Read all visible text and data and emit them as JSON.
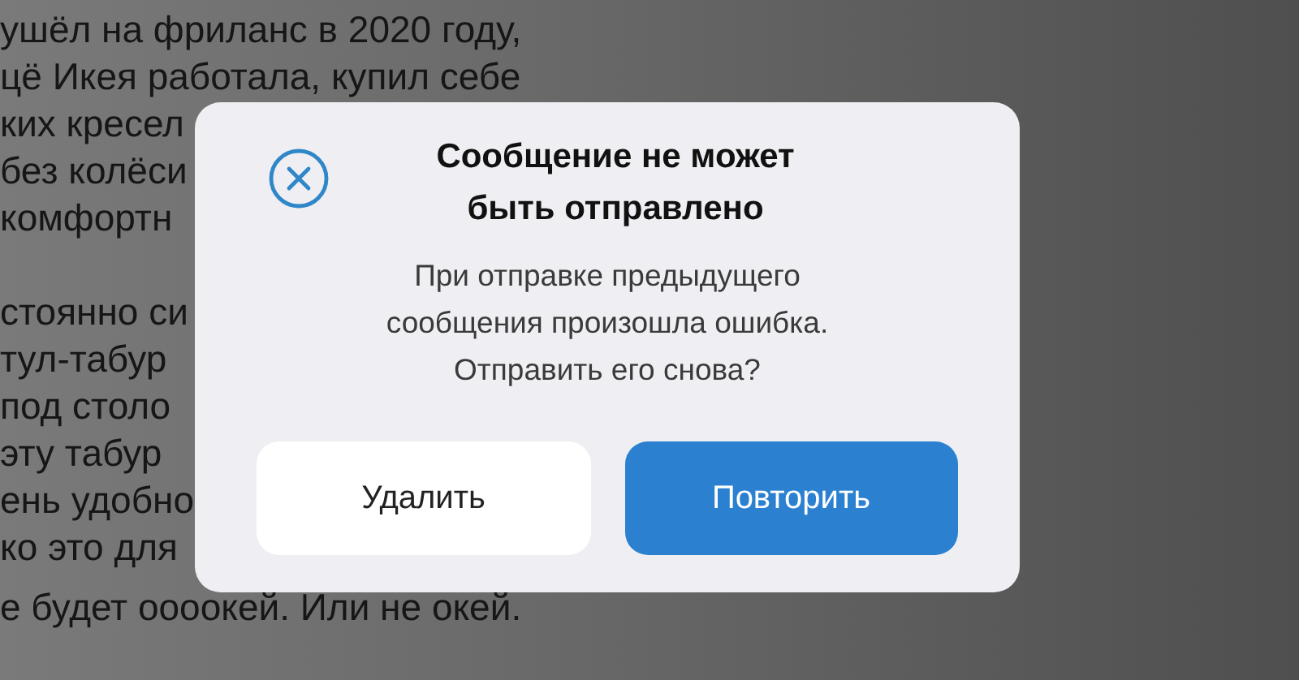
{
  "background_paragraphs": [
    [
      "ушёл на фриланс в 2020 году,",
      "цё Икея работала, купил себе",
      "ких кресел",
      "без колёси",
      "комфортн"
    ],
    [
      "стоянно си",
      "тул-табур",
      "под столо",
      "эту табур",
      "ень удобно",
      "ко это для",
      "е будет оооокей. Или не окей."
    ]
  ],
  "dialog": {
    "title": "Сообщение не может быть отправлено",
    "message": "При отправке предыдущего сообщения произошла ошибка. Отправить его снова?",
    "buttons": [
      {
        "label": "Удалить",
        "kind": "secondary"
      },
      {
        "label": "Повторить",
        "kind": "primary"
      }
    ]
  }
}
